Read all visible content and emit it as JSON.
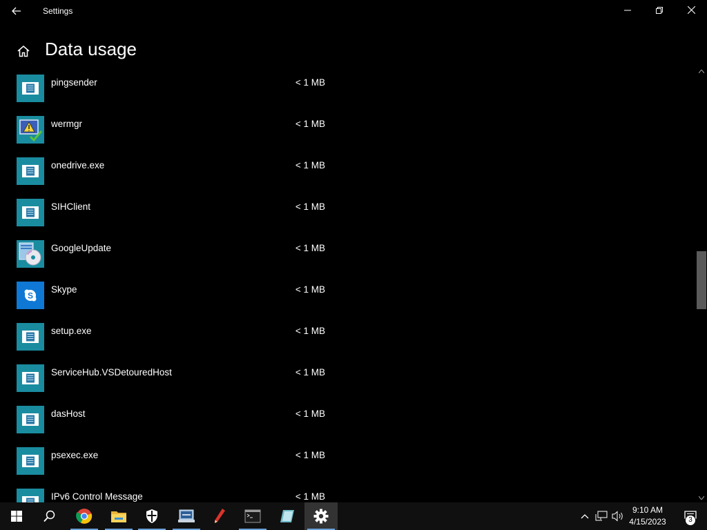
{
  "window": {
    "title": "Settings",
    "back_icon": "back-arrow-icon",
    "minimize_icon": "minimize-icon",
    "restore_icon": "restore-icon",
    "close_icon": "close-icon"
  },
  "header": {
    "home_icon": "home-icon",
    "title": "Data usage"
  },
  "apps": [
    {
      "name": "pingsender",
      "usage": "< 1 MB",
      "icon": "generic-app-icon"
    },
    {
      "name": "wermgr",
      "usage": "< 1 MB",
      "icon": "error-reporting-icon"
    },
    {
      "name": "onedrive.exe",
      "usage": "< 1 MB",
      "icon": "generic-app-icon"
    },
    {
      "name": "SIHClient",
      "usage": "< 1 MB",
      "icon": "generic-app-icon"
    },
    {
      "name": "GoogleUpdate",
      "usage": "< 1 MB",
      "icon": "installer-icon"
    },
    {
      "name": "Skype",
      "usage": "< 1 MB",
      "icon": "skype-icon"
    },
    {
      "name": "setup.exe",
      "usage": "< 1 MB",
      "icon": "generic-app-icon"
    },
    {
      "name": "ServiceHub.VSDetouredHost",
      "usage": "< 1 MB",
      "icon": "generic-app-icon"
    },
    {
      "name": "dasHost",
      "usage": "< 1 MB",
      "icon": "generic-app-icon"
    },
    {
      "name": "psexec.exe",
      "usage": "< 1 MB",
      "icon": "generic-app-icon"
    },
    {
      "name": "IPv6 Control Message",
      "usage": "< 1 MB",
      "icon": "generic-app-icon"
    }
  ],
  "scrollbar": {
    "position_fraction": 0.43
  },
  "taskbar": {
    "items": [
      "start-icon",
      "search-icon",
      "chrome-icon",
      "file-explorer-icon",
      "security-shield-icon",
      "network-tool-icon",
      "pen-app-icon",
      "terminal-icon",
      "notebook-app-icon",
      "settings-gear-icon"
    ],
    "active": "settings-gear-icon",
    "tray": [
      "show-hidden-icons-chevron",
      "network-icon",
      "volume-icon"
    ],
    "time": "9:10 AM",
    "date": "4/15/2023",
    "notification_count": "3"
  },
  "colors": {
    "background": "#000000",
    "app_tile": "#1a8ca0",
    "skype_tile": "#0f78d4",
    "taskbar": "#101010",
    "active_underline": "#6aa0d8"
  }
}
